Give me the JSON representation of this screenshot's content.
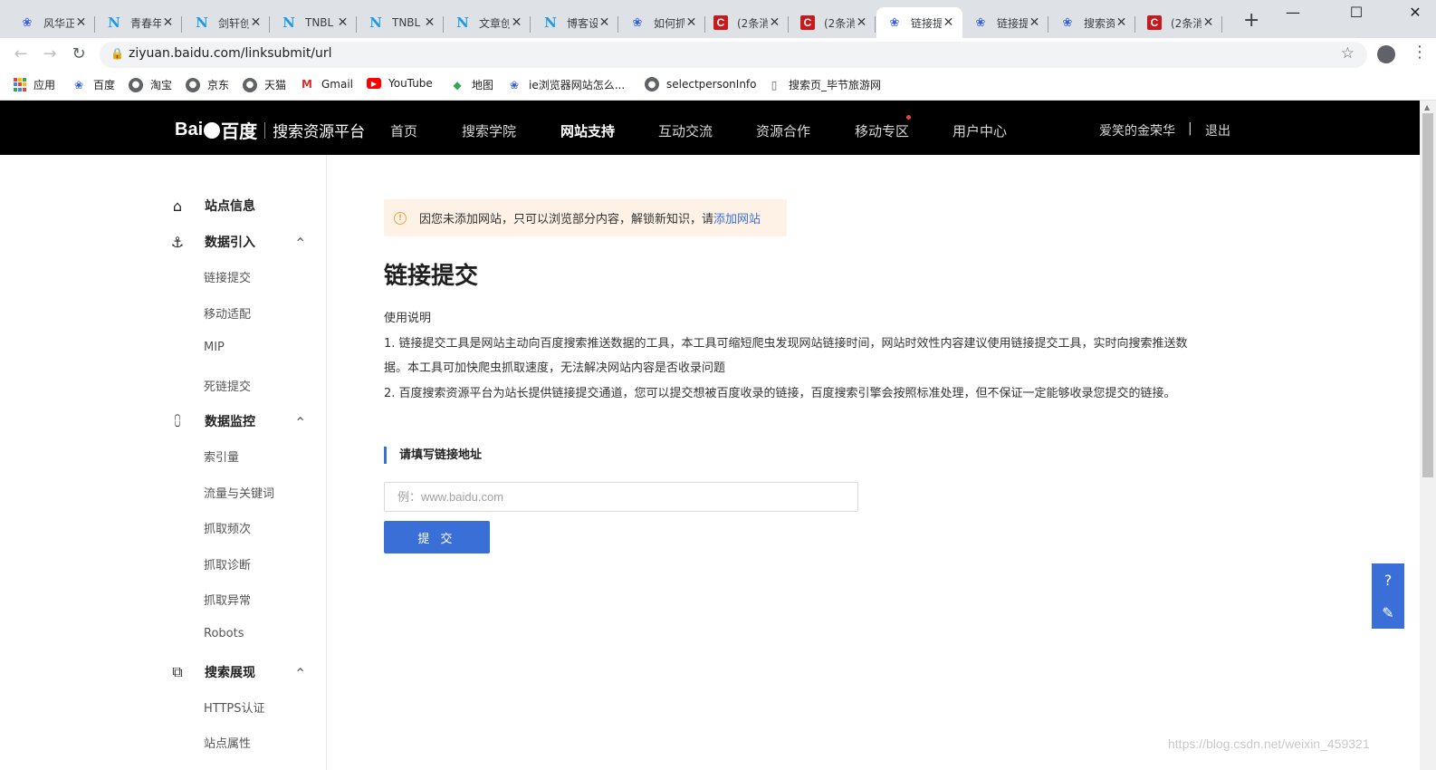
{
  "browser": {
    "tabs": [
      {
        "title": "风华正",
        "icon": "paw-icon",
        "active": false
      },
      {
        "title": "青春年",
        "icon": "tn-icon",
        "active": false
      },
      {
        "title": "剑轩创",
        "icon": "tn-icon",
        "active": false
      },
      {
        "title": "TNBL",
        "icon": "tn-icon",
        "active": false
      },
      {
        "title": "TNBL",
        "icon": "tn-icon",
        "active": false
      },
      {
        "title": "文章创",
        "icon": "tn-icon",
        "active": false
      },
      {
        "title": "博客设",
        "icon": "tn-icon",
        "active": false
      },
      {
        "title": "如何抓",
        "icon": "paw-icon",
        "active": false
      },
      {
        "title": "(2条消",
        "icon": "csdn-icon",
        "active": false
      },
      {
        "title": "(2条消",
        "icon": "csdn-icon",
        "active": false
      },
      {
        "title": "链接提",
        "icon": "paw-icon",
        "active": true
      },
      {
        "title": "链接提",
        "icon": "paw-icon",
        "active": false
      },
      {
        "title": "搜索资",
        "icon": "paw-icon",
        "active": false
      },
      {
        "title": "(2条消",
        "icon": "csdn-icon",
        "active": false
      }
    ],
    "url": "ziyuan.baidu.com/linksubmit/url",
    "bookmarks": [
      {
        "label": "应用",
        "icon": "apps-icon"
      },
      {
        "label": "百度",
        "icon": "paw-icon"
      },
      {
        "label": "淘宝",
        "icon": "globe-icon"
      },
      {
        "label": "京东",
        "icon": "globe-icon"
      },
      {
        "label": "天猫",
        "icon": "globe-icon"
      },
      {
        "label": "Gmail",
        "icon": "gmail-icon"
      },
      {
        "label": "YouTube",
        "icon": "youtube-icon"
      },
      {
        "label": "地图",
        "icon": "maps-icon"
      },
      {
        "label": "ie浏览器网站怎么...",
        "icon": "paw-icon"
      },
      {
        "label": "selectpersonInfo",
        "icon": "globe-icon"
      },
      {
        "label": "搜索页_毕节旅游网",
        "icon": "page-icon"
      }
    ]
  },
  "topnav": {
    "logo_text": "Bai",
    "logo_text2": "百度",
    "platform": "搜索资源平台",
    "items": [
      "首页",
      "搜索学院",
      "网站支持",
      "互动交流",
      "资源合作",
      "移动专区",
      "用户中心"
    ],
    "active_index": 2,
    "username": "爱笑的金荣华",
    "separator": "|",
    "logout": "退出"
  },
  "sidebar": {
    "sections": [
      {
        "label": "站点信息",
        "icon": "home-icon",
        "children": []
      },
      {
        "label": "数据引入",
        "icon": "data-import-icon",
        "children": [
          "链接提交",
          "移动适配",
          "MIP",
          "死链提交"
        ]
      },
      {
        "label": "数据监控",
        "icon": "chart-icon",
        "children": [
          "索引量",
          "流量与关键词",
          "抓取频次",
          "抓取诊断",
          "抓取异常",
          "Robots"
        ]
      },
      {
        "label": "搜索展现",
        "icon": "search-display-icon",
        "children": [
          "HTTPS认证",
          "站点属性"
        ]
      }
    ]
  },
  "main": {
    "notice_text": "因您未添加网站，只可以浏览部分内容，解锁新知识，请",
    "notice_link": "添加网站",
    "title": "链接提交",
    "usage_title": "使用说明",
    "usage_lines": [
      "1. 链接提交工具是网站主动向百度搜索推送数据的工具，本工具可缩短爬虫发现网站链接时间，网站时效性内容建议使用链接提交工具，实时向搜索推送数",
      "据。本工具可加快爬虫抓取速度，无法解决网站内容是否收录问题",
      "2. 百度搜索资源平台为站长提供链接提交通道，您可以提交想被百度收录的链接，百度搜索引擎会按照标准处理，但不保证一定能够收录您提交的链接。"
    ],
    "section_title": "请填写链接地址",
    "input_placeholder": "例：www.baidu.com",
    "submit_label": "提 交"
  },
  "watermark": "https://blog.csdn.net/weixin_459321",
  "colors": {
    "accent": "#3b6fd8",
    "nav_bg": "#000000",
    "notice_bg": "#fdf2e5"
  }
}
